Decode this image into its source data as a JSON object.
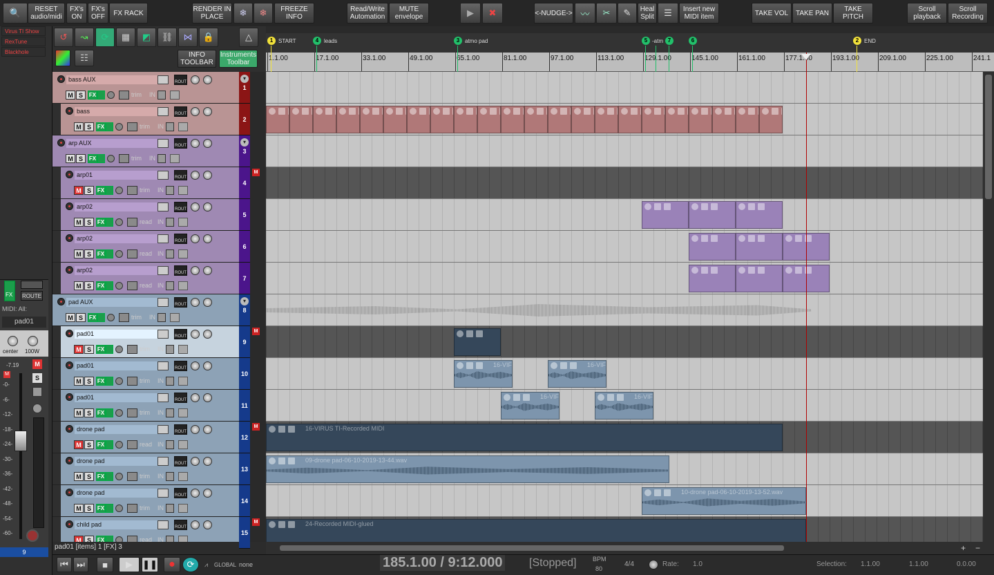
{
  "toolbar": {
    "reset": "RESET\naudio/midi",
    "fx_on": "FX's\nON",
    "fx_off": "FX's\nOFF",
    "fx_rack": "FX RACK",
    "render": "RENDER IN\nPLACE",
    "freeze": "FREEZE\nINFO",
    "rw_auto": "Read/Write\nAutomation",
    "mute_env": "MUTE\nenvelope",
    "nudge": "<-NUDGE->",
    "heal": "Heal\nSplit",
    "insert_midi": "Insert new\nMIDI item",
    "take_vol": "TAKE VOL",
    "take_pan": "TAKE PAN",
    "take_pitch": "TAKE\nPITCH",
    "scroll_play": "Scroll\nplayback",
    "scroll_rec": "Scroll\nRecording",
    "info_toolbar": "INFO\nTOOLBAR",
    "instr_toolbar": "Instruments\nToolbar"
  },
  "left_menu": [
    "Virus TI Show",
    "RexTune",
    "Blackhole"
  ],
  "mixer": {
    "midi_label": "MIDI: All:",
    "track_name": "pad01",
    "pan_label": "center",
    "width_label": "100W",
    "route": "ROUTE",
    "fx": "FX",
    "peak": "-7.19",
    "track_number": "9",
    "scale": [
      "-0-",
      "-6-",
      "-12-",
      "-18-",
      "-24-",
      "-30-",
      "-36-",
      "-42-",
      "-48-",
      "-54-",
      "-60-"
    ],
    "fader_level_db": -24
  },
  "markers": [
    {
      "n": "1",
      "label": "START",
      "color": "#f2e23a"
    },
    {
      "n": "4",
      "label": "leads",
      "color": "#22c06a"
    },
    {
      "n": "3",
      "label": "atmo pad",
      "color": "#22c06a"
    },
    {
      "n": "5",
      "label": "",
      "color": "#22c06a"
    },
    {
      "n": "",
      "label": "-atm",
      "color": ""
    },
    {
      "n": "7",
      "label": "",
      "color": "#22c06a"
    },
    {
      "n": "6",
      "label": "",
      "color": "#22c06a"
    },
    {
      "n": "2",
      "label": "END",
      "color": "#f2e23a"
    }
  ],
  "ruler_labels": [
    "1.1.00",
    "17.1.00",
    "33.1.00",
    "49.1.00",
    "65.1.00",
    "81.1.00",
    "97.1.00",
    "113.1.00",
    "129.1.00",
    "145.1.00",
    "161.1.00",
    "177.1.00",
    "193.1.00",
    "209.1.00",
    "225.1.00",
    "241.1"
  ],
  "track_common": {
    "m": "M",
    "s": "S",
    "fx": "FX",
    "in": "IN",
    "rout": "ROUT"
  },
  "tracks": [
    {
      "num": "1",
      "name": "bass AUX",
      "color": "#b99494",
      "num_color": "#8b1515",
      "auto": "trim",
      "m_red": false,
      "folder": true,
      "mark": false
    },
    {
      "num": "2",
      "name": "bass",
      "color": "#b99494",
      "num_color": "#8b1515",
      "auto": "trim",
      "m_red": false,
      "folder": false,
      "mark": false
    },
    {
      "num": "3",
      "name": "arp AUX",
      "color": "#9f89b3",
      "num_color": "#4b158b",
      "auto": "trim",
      "m_red": false,
      "folder": true,
      "mark": false
    },
    {
      "num": "4",
      "name": "arp01",
      "color": "#9f89b3",
      "num_color": "#4b158b",
      "auto": "trim",
      "m_red": true,
      "folder": false,
      "mark": true
    },
    {
      "num": "5",
      "name": "arp02",
      "color": "#9f89b3",
      "num_color": "#4b158b",
      "auto": "read",
      "m_red": false,
      "folder": false,
      "mark": false
    },
    {
      "num": "6",
      "name": "arp02",
      "color": "#9f89b3",
      "num_color": "#4b158b",
      "auto": "read",
      "m_red": false,
      "folder": false,
      "mark": false
    },
    {
      "num": "7",
      "name": "arp02",
      "color": "#9f89b3",
      "num_color": "#4b158b",
      "auto": "read",
      "m_red": false,
      "folder": false,
      "mark": false
    },
    {
      "num": "8",
      "name": "pad AUX",
      "color": "#8da2b6",
      "num_color": "#153a8b",
      "auto": "trim",
      "m_red": false,
      "folder": true,
      "mark": false
    },
    {
      "num": "9",
      "name": "pad01",
      "color": "#c6d3de",
      "num_color": "#153a8b",
      "auto": "trim",
      "m_red": true,
      "folder": false,
      "mark": true
    },
    {
      "num": "10",
      "name": "pad01",
      "color": "#8da2b6",
      "num_color": "#153a8b",
      "auto": "trim",
      "m_red": false,
      "folder": false,
      "mark": false
    },
    {
      "num": "11",
      "name": "pad01",
      "color": "#8da2b6",
      "num_color": "#153a8b",
      "auto": "trim",
      "m_red": false,
      "folder": false,
      "mark": false
    },
    {
      "num": "12",
      "name": "drone pad",
      "color": "#8da2b6",
      "num_color": "#153a8b",
      "auto": "read",
      "m_red": true,
      "folder": false,
      "mark": true
    },
    {
      "num": "13",
      "name": "drone pad",
      "color": "#8da2b6",
      "num_color": "#153a8b",
      "auto": "trim",
      "m_red": false,
      "folder": false,
      "mark": false
    },
    {
      "num": "14",
      "name": "drone pad",
      "color": "#8da2b6",
      "num_color": "#153a8b",
      "auto": "trim",
      "m_red": false,
      "folder": false,
      "mark": false
    },
    {
      "num": "15",
      "name": "child pad",
      "color": "#8da2b6",
      "num_color": "#153a8b",
      "auto": "read",
      "m_red": true,
      "folder": false,
      "mark": true
    }
  ],
  "item_labels": {
    "virus": "16-VIRUS TI-Recorded MIDI",
    "vir": "16-VIF",
    "drone1": "09-drone pad-06-10-2019-13-44.wav",
    "drone2": "10-drone pad-06-10-2019-13-52.wav",
    "recorded": "24-Recorded MIDI-glued"
  },
  "status": {
    "selected": "pad01 [items] 1 [FX] 3"
  },
  "transport": {
    "position": "185.1.00 / 9:12.000",
    "state": "[Stopped]",
    "bpm_label": "BPM",
    "bpm": "80",
    "timesig": "4/4",
    "rate_label": "Rate:",
    "rate": "1.0",
    "global": "GLOBAL",
    "none": "none",
    "selection_label": "Selection:",
    "sel_start": "1.1.00",
    "sel_end": "1.1.00",
    "sel_len": "0.0.00"
  }
}
